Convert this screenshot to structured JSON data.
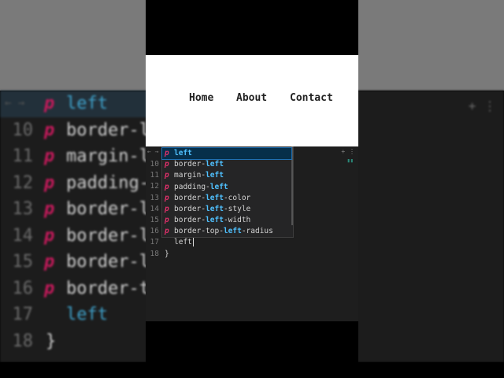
{
  "preview": {
    "nav": [
      {
        "label": "Home"
      },
      {
        "label": "About"
      },
      {
        "label": "Contact"
      }
    ]
  },
  "editor": {
    "line_numbers": [
      "10",
      "11",
      "12",
      "13",
      "14",
      "15",
      "16",
      "17",
      "18"
    ],
    "typed_text": "left",
    "closing_brace": "}",
    "suggestions": [
      {
        "prefix": "",
        "match": "left",
        "suffix": "",
        "icon": "p"
      },
      {
        "prefix": "border-",
        "match": "left",
        "suffix": "",
        "icon": "p"
      },
      {
        "prefix": "margin-",
        "match": "left",
        "suffix": "",
        "icon": "p"
      },
      {
        "prefix": "padding-",
        "match": "left",
        "suffix": "",
        "icon": "p"
      },
      {
        "prefix": "border-",
        "match": "left",
        "suffix": "-color",
        "icon": "p"
      },
      {
        "prefix": "border-",
        "match": "left",
        "suffix": "-style",
        "icon": "p"
      },
      {
        "prefix": "border-",
        "match": "left",
        "suffix": "-width",
        "icon": "p"
      },
      {
        "prefix": "border-top-",
        "match": "left",
        "suffix": "-radius",
        "icon": "p"
      }
    ]
  },
  "background": {
    "lines": [
      {
        "num": "",
        "text": "left",
        "hl": true
      },
      {
        "num": "10",
        "text": "border-l"
      },
      {
        "num": "11",
        "text": "margin-l"
      },
      {
        "num": "12",
        "text": "padding-"
      },
      {
        "num": "13",
        "text": "border-l"
      },
      {
        "num": "14",
        "text": "border-l"
      },
      {
        "num": "15",
        "text": "border-l"
      },
      {
        "num": "16",
        "text": "border-t"
      },
      {
        "num": "17",
        "text": "left",
        "typed": true
      },
      {
        "num": "18",
        "text": "}"
      }
    ]
  },
  "colors": {
    "accent_keyword": "#4fc1ff",
    "property_icon": "#e0306a",
    "editor_bg": "#1e1e1e",
    "selection_bg": "#062f4a"
  }
}
